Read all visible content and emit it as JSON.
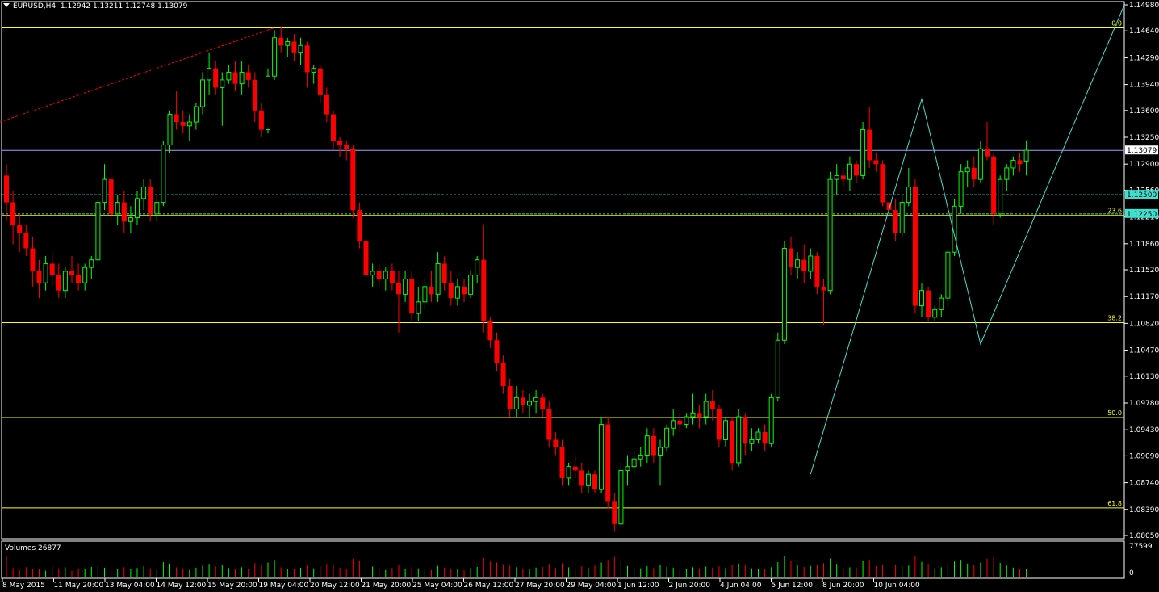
{
  "header": {
    "symbol": "EURUSD,H4",
    "open": "1.12942",
    "high": "1.13211",
    "low": "1.12748",
    "close": "1.13079"
  },
  "volume_panel": {
    "label": "Volumes 26877",
    "axis_max_label": "77599",
    "axis_min_label": "0"
  },
  "colors": {
    "background": "#000000",
    "grid_frame": "#ffffff",
    "bull": "#00ff00",
    "bear": "#ff0000",
    "fibo": "#ffff00",
    "zigzag": "#40e0d0",
    "hline": "#a0a0ff",
    "trend": "#ff0000",
    "price_tag_bg": "#ffffff",
    "level_tag_bg": "#40e0d0"
  },
  "chart_data": {
    "type": "candlestick",
    "symbol": "EURUSD",
    "timeframe": "H4",
    "price_axis_ticks": [
      "1.14980",
      "1.14640",
      "1.14290",
      "1.13940",
      "1.13600",
      "1.13250",
      "1.12900",
      "1.12560",
      "1.12210",
      "1.11860",
      "1.11520",
      "1.11170",
      "1.10820",
      "1.10470",
      "1.10130",
      "1.09780",
      "1.09430",
      "1.09090",
      "1.08740",
      "1.08390",
      "1.08050"
    ],
    "ylim": [
      1.0805,
      1.1498
    ],
    "time_axis_labels": [
      "8 May 2015",
      "11 May 20:00",
      "13 May 04:00",
      "14 May 12:00",
      "15 May 20:00",
      "19 May 04:00",
      "20 May 12:00",
      "21 May 20:00",
      "25 May 04:00",
      "26 May 12:00",
      "27 May 20:00",
      "29 May 04:00",
      "1 Jun 12:00",
      "2 Jun 20:00",
      "4 Jun 04:00",
      "5 Jun 12:00",
      "8 Jun 20:00",
      "10 Jun 04:00"
    ],
    "current_price": "1.13079",
    "horizontal_levels": [
      {
        "tag": "1.12500",
        "value": 1.125,
        "style": "dashed"
      },
      {
        "tag": "1.12250",
        "value": 1.1225,
        "style": "dashed"
      }
    ],
    "fibonacci": [
      {
        "label": "0.0",
        "value": 1.1468
      },
      {
        "label": "23.6",
        "value": 1.1223
      },
      {
        "label": "38.2",
        "value": 1.1083
      },
      {
        "label": "50.0",
        "value": 1.0959
      },
      {
        "label": "61.8",
        "value": 1.0841
      }
    ],
    "candles_ohlc": [
      [
        1.1275,
        1.129,
        1.1215,
        1.124
      ],
      [
        1.124,
        1.1255,
        1.1185,
        1.121
      ],
      [
        1.121,
        1.1225,
        1.1175,
        1.12
      ],
      [
        1.12,
        1.121,
        1.117,
        1.118
      ],
      [
        1.118,
        1.1195,
        1.113,
        1.115
      ],
      [
        1.115,
        1.1165,
        1.1115,
        1.1135
      ],
      [
        1.1135,
        1.117,
        1.1125,
        1.116
      ],
      [
        1.116,
        1.1175,
        1.113,
        1.1145
      ],
      [
        1.1145,
        1.116,
        1.1115,
        1.1125
      ],
      [
        1.1125,
        1.1155,
        1.1115,
        1.115
      ],
      [
        1.115,
        1.117,
        1.1135,
        1.1145
      ],
      [
        1.1145,
        1.116,
        1.1125,
        1.1135
      ],
      [
        1.1135,
        1.116,
        1.1125,
        1.1155
      ],
      [
        1.1155,
        1.117,
        1.114,
        1.1165
      ],
      [
        1.1165,
        1.1245,
        1.116,
        1.124
      ],
      [
        1.124,
        1.129,
        1.123,
        1.127
      ],
      [
        1.127,
        1.128,
        1.1215,
        1.1225
      ],
      [
        1.1225,
        1.125,
        1.121,
        1.124
      ],
      [
        1.124,
        1.1255,
        1.12,
        1.1215
      ],
      [
        1.1215,
        1.1235,
        1.12,
        1.122
      ],
      [
        1.122,
        1.1255,
        1.121,
        1.1245
      ],
      [
        1.1245,
        1.127,
        1.123,
        1.126
      ],
      [
        1.126,
        1.127,
        1.1215,
        1.1225
      ],
      [
        1.1225,
        1.125,
        1.1215,
        1.124
      ],
      [
        1.124,
        1.132,
        1.1235,
        1.1315
      ],
      [
        1.1315,
        1.136,
        1.1305,
        1.1355
      ],
      [
        1.1355,
        1.1385,
        1.1335,
        1.1345
      ],
      [
        1.1345,
        1.136,
        1.133,
        1.134
      ],
      [
        1.134,
        1.1355,
        1.132,
        1.1345
      ],
      [
        1.1345,
        1.137,
        1.1335,
        1.1365
      ],
      [
        1.1365,
        1.141,
        1.1355,
        1.14
      ],
      [
        1.14,
        1.1435,
        1.138,
        1.1415
      ],
      [
        1.1415,
        1.1425,
        1.138,
        1.139
      ],
      [
        1.139,
        1.141,
        1.134,
        1.14
      ],
      [
        1.14,
        1.142,
        1.1395,
        1.141
      ],
      [
        1.141,
        1.1425,
        1.1385,
        1.1395
      ],
      [
        1.1395,
        1.1425,
        1.138,
        1.141
      ],
      [
        1.141,
        1.142,
        1.139,
        1.14
      ],
      [
        1.14,
        1.141,
        1.1345,
        1.136
      ],
      [
        1.136,
        1.137,
        1.1325,
        1.1335
      ],
      [
        1.1335,
        1.1415,
        1.133,
        1.1405
      ],
      [
        1.1405,
        1.1465,
        1.14,
        1.1455
      ],
      [
        1.1455,
        1.147,
        1.1435,
        1.1445
      ],
      [
        1.1445,
        1.1455,
        1.143,
        1.145
      ],
      [
        1.145,
        1.146,
        1.1425,
        1.1435
      ],
      [
        1.1435,
        1.1455,
        1.142,
        1.1445
      ],
      [
        1.1445,
        1.145,
        1.139,
        1.141
      ],
      [
        1.141,
        1.142,
        1.1395,
        1.1415
      ],
      [
        1.1415,
        1.142,
        1.137,
        1.138
      ],
      [
        1.138,
        1.139,
        1.1345,
        1.1355
      ],
      [
        1.1355,
        1.136,
        1.131,
        1.132
      ],
      [
        1.132,
        1.1325,
        1.13,
        1.1315
      ],
      [
        1.1315,
        1.132,
        1.1295,
        1.131
      ],
      [
        1.131,
        1.1315,
        1.122,
        1.123
      ],
      [
        1.123,
        1.124,
        1.118,
        1.119
      ],
      [
        1.119,
        1.12,
        1.113,
        1.1145
      ],
      [
        1.1145,
        1.116,
        1.113,
        1.115
      ],
      [
        1.115,
        1.116,
        1.113,
        1.114
      ],
      [
        1.114,
        1.1155,
        1.1125,
        1.115
      ],
      [
        1.115,
        1.116,
        1.1125,
        1.1135
      ],
      [
        1.1135,
        1.115,
        1.107,
        1.112
      ],
      [
        1.112,
        1.115,
        1.111,
        1.114
      ],
      [
        1.114,
        1.115,
        1.1085,
        1.1095
      ],
      [
        1.1095,
        1.113,
        1.1085,
        1.111
      ],
      [
        1.111,
        1.114,
        1.11,
        1.113
      ],
      [
        1.113,
        1.115,
        1.111,
        1.112
      ],
      [
        1.112,
        1.1175,
        1.111,
        1.116
      ],
      [
        1.116,
        1.117,
        1.1125,
        1.1135
      ],
      [
        1.1135,
        1.115,
        1.1105,
        1.1115
      ],
      [
        1.1115,
        1.114,
        1.1105,
        1.113
      ],
      [
        1.113,
        1.114,
        1.111,
        1.112
      ],
      [
        1.112,
        1.115,
        1.1115,
        1.1145
      ],
      [
        1.1145,
        1.117,
        1.1135,
        1.1165
      ],
      [
        1.1165,
        1.121,
        1.107,
        1.1085
      ],
      [
        1.1085,
        1.109,
        1.105,
        1.106
      ],
      [
        1.106,
        1.107,
        1.102,
        1.103
      ],
      [
        1.103,
        1.104,
        1.099,
        1.1
      ],
      [
        1.1,
        1.101,
        1.096,
        1.097
      ],
      [
        1.097,
        1.1,
        1.096,
        1.0985
      ],
      [
        1.0985,
        1.0995,
        1.0965,
        1.0975
      ],
      [
        1.0975,
        1.099,
        1.096,
        1.098
      ],
      [
        1.098,
        1.0995,
        1.0965,
        1.0985
      ],
      [
        1.0985,
        1.099,
        1.096,
        1.097
      ],
      [
        1.097,
        1.098,
        1.092,
        1.093
      ],
      [
        1.093,
        1.094,
        1.091,
        1.092
      ],
      [
        1.092,
        1.093,
        1.087,
        1.088
      ],
      [
        1.088,
        1.09,
        1.087,
        1.0895
      ],
      [
        1.0895,
        1.091,
        1.088,
        1.089
      ],
      [
        1.089,
        1.09,
        1.086,
        1.087
      ],
      [
        1.087,
        1.089,
        1.086,
        1.0885
      ],
      [
        1.0885,
        1.089,
        1.086,
        1.0865
      ],
      [
        1.0865,
        1.096,
        1.086,
        1.095
      ],
      [
        1.095,
        1.096,
        1.084,
        1.085
      ],
      [
        1.085,
        1.086,
        1.081,
        1.082
      ],
      [
        1.082,
        1.09,
        1.0815,
        1.089
      ],
      [
        1.089,
        1.091,
        1.087,
        1.0895
      ],
      [
        1.0895,
        1.0915,
        1.0885,
        1.0905
      ],
      [
        1.0905,
        1.092,
        1.0895,
        1.091
      ],
      [
        1.091,
        1.0945,
        1.09,
        1.0935
      ],
      [
        1.0935,
        1.0945,
        1.09,
        1.091
      ],
      [
        1.091,
        1.093,
        1.087,
        1.092
      ],
      [
        1.092,
        1.095,
        1.0915,
        1.0945
      ],
      [
        1.0945,
        1.097,
        1.0935,
        1.0955
      ],
      [
        1.0955,
        1.0965,
        1.094,
        1.095
      ],
      [
        1.095,
        1.0965,
        1.0945,
        1.096
      ],
      [
        1.096,
        1.099,
        1.095,
        1.0965
      ],
      [
        1.0965,
        1.0975,
        1.0945,
        1.096
      ],
      [
        1.096,
        1.099,
        1.095,
        1.098
      ],
      [
        1.098,
        1.0995,
        1.0955,
        1.097
      ],
      [
        1.097,
        1.0975,
        1.092,
        1.093
      ],
      [
        1.093,
        1.096,
        1.092,
        1.0955
      ],
      [
        1.0955,
        1.096,
        1.089,
        1.09
      ],
      [
        1.09,
        1.097,
        1.0895,
        1.096
      ],
      [
        1.096,
        1.0965,
        1.091,
        1.0925
      ],
      [
        1.0925,
        1.0945,
        1.0915,
        1.093
      ],
      [
        1.093,
        1.0945,
        1.0925,
        1.094
      ],
      [
        1.094,
        1.095,
        1.0915,
        1.0925
      ],
      [
        1.0925,
        1.099,
        1.092,
        1.0985
      ],
      [
        1.0985,
        1.107,
        1.098,
        1.106
      ],
      [
        1.106,
        1.119,
        1.1055,
        1.118
      ],
      [
        1.118,
        1.1195,
        1.1145,
        1.1155
      ],
      [
        1.1155,
        1.1175,
        1.114,
        1.1165
      ],
      [
        1.1165,
        1.1185,
        1.1135,
        1.115
      ],
      [
        1.115,
        1.118,
        1.114,
        1.117
      ],
      [
        1.117,
        1.1175,
        1.112,
        1.113
      ],
      [
        1.113,
        1.114,
        1.108,
        1.1125
      ],
      [
        1.1125,
        1.128,
        1.112,
        1.127
      ],
      [
        1.127,
        1.129,
        1.125,
        1.1275
      ],
      [
        1.1275,
        1.1285,
        1.126,
        1.127
      ],
      [
        1.127,
        1.13,
        1.1255,
        1.129
      ],
      [
        1.129,
        1.1295,
        1.1265,
        1.1275
      ],
      [
        1.1275,
        1.1345,
        1.127,
        1.1335
      ],
      [
        1.1335,
        1.1365,
        1.1285,
        1.1295
      ],
      [
        1.1295,
        1.1305,
        1.128,
        1.129
      ],
      [
        1.129,
        1.1295,
        1.1235,
        1.124
      ],
      [
        1.124,
        1.1255,
        1.1215,
        1.123
      ],
      [
        1.123,
        1.1245,
        1.119,
        1.12
      ],
      [
        1.12,
        1.125,
        1.1195,
        1.124
      ],
      [
        1.124,
        1.1285,
        1.1235,
        1.126
      ],
      [
        1.126,
        1.127,
        1.1095,
        1.1105
      ],
      [
        1.1105,
        1.1135,
        1.109,
        1.1125
      ],
      [
        1.1125,
        1.113,
        1.1085,
        1.109
      ],
      [
        1.109,
        1.1105,
        1.1085,
        1.11
      ],
      [
        1.11,
        1.112,
        1.109,
        1.1115
      ],
      [
        1.1115,
        1.118,
        1.1105,
        1.1175
      ],
      [
        1.1175,
        1.1245,
        1.117,
        1.1235
      ],
      [
        1.1235,
        1.129,
        1.1225,
        1.128
      ],
      [
        1.128,
        1.1295,
        1.126,
        1.1285
      ],
      [
        1.1285,
        1.13,
        1.126,
        1.127
      ],
      [
        1.127,
        1.132,
        1.1265,
        1.131
      ],
      [
        1.131,
        1.1345,
        1.1295,
        1.13
      ],
      [
        1.13,
        1.1305,
        1.121,
        1.1225
      ],
      [
        1.1225,
        1.1275,
        1.122,
        1.127
      ],
      [
        1.127,
        1.129,
        1.1255,
        1.1285
      ],
      [
        1.1285,
        1.13,
        1.1275,
        1.1295
      ],
      [
        1.1295,
        1.1305,
        1.128,
        1.129
      ],
      [
        1.1294,
        1.1321,
        1.1275,
        1.1308
      ]
    ],
    "volumes": [
      0.62,
      0.28,
      0.22,
      0.3,
      0.24,
      0.26,
      0.2,
      0.33,
      0.25,
      0.3,
      0.19,
      0.27,
      0.24,
      0.31,
      0.38,
      0.29,
      0.22,
      0.26,
      0.3,
      0.24,
      0.28,
      0.33,
      0.27,
      0.22,
      0.45,
      0.41,
      0.3,
      0.26,
      0.22,
      0.29,
      0.35,
      0.4,
      0.33,
      0.37,
      0.28,
      0.24,
      0.3,
      0.26,
      0.42,
      0.36,
      0.44,
      0.52,
      0.3,
      0.26,
      0.24,
      0.29,
      0.38,
      0.27,
      0.33,
      0.4,
      0.35,
      0.29,
      0.25,
      0.55,
      0.48,
      0.41,
      0.32,
      0.26,
      0.22,
      0.28,
      0.37,
      0.24,
      0.3,
      0.27,
      0.25,
      0.22,
      0.34,
      0.29,
      0.24,
      0.26,
      0.21,
      0.28,
      0.31,
      0.58,
      0.47,
      0.44,
      0.39,
      0.35,
      0.3,
      0.27,
      0.26,
      0.29,
      0.31,
      0.4,
      0.28,
      0.42,
      0.3,
      0.27,
      0.33,
      0.29,
      0.35,
      0.44,
      0.52,
      0.6,
      0.48,
      0.34,
      0.3,
      0.27,
      0.33,
      0.28,
      0.37,
      0.31,
      0.29,
      0.25,
      0.26,
      0.3,
      0.27,
      0.32,
      0.29,
      0.33,
      0.28,
      0.36,
      0.41,
      0.38,
      0.27,
      0.24,
      0.26,
      0.3,
      0.45,
      0.62,
      0.5,
      0.38,
      0.31,
      0.34,
      0.36,
      0.42,
      0.56,
      0.4,
      0.27,
      0.3,
      0.29,
      0.48,
      0.52,
      0.33,
      0.37,
      0.31,
      0.36,
      0.33,
      0.35,
      0.64,
      0.46,
      0.4,
      0.28,
      0.3,
      0.39,
      0.47,
      0.52,
      0.41,
      0.36,
      0.44,
      0.55,
      0.6,
      0.43,
      0.35,
      0.29,
      0.26,
      0.24
    ],
    "zigzag_points": [
      [
        123,
        1.0885
      ],
      [
        140,
        1.1375
      ],
      [
        149,
        1.1055
      ],
      [
        171,
        1.1498
      ]
    ],
    "trendline": {
      "from": [
        0,
        1.1345
      ],
      "to": [
        41,
        1.1468
      ]
    }
  }
}
